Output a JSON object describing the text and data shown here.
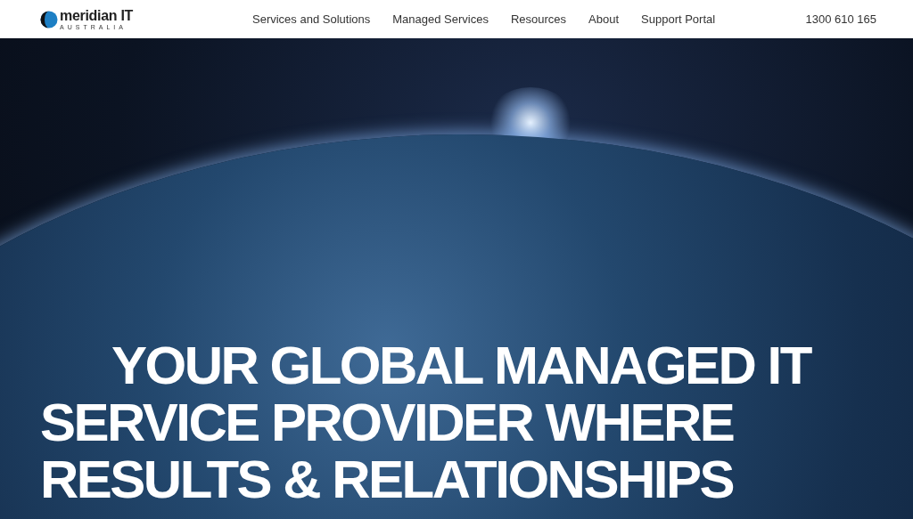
{
  "header": {
    "logo": {
      "name": "meridian IT",
      "tagline": "AUSTRALIA"
    },
    "nav": [
      {
        "label": "Services and Solutions"
      },
      {
        "label": "Managed Services"
      },
      {
        "label": "Resources"
      },
      {
        "label": "About"
      },
      {
        "label": "Support Portal"
      }
    ],
    "phone": "1300 610 165"
  },
  "hero": {
    "heading": "YOUR GLOBAL MANAGED IT SERVICE PROVIDER WHERE RESULTS & RELATIONSHIPS"
  }
}
